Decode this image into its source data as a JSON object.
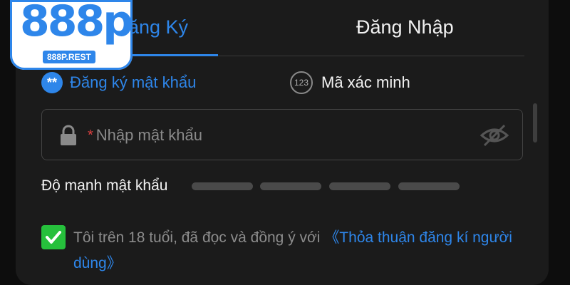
{
  "logo": {
    "brand": "888p",
    "domain": "888P.REST"
  },
  "tabs": {
    "register": "ăng Ký",
    "login": "Đăng Nhập"
  },
  "methods": {
    "password_icon": "**",
    "password": "Đăng ký mật khẩu",
    "code_icon": "123",
    "code": "Mã xác minh"
  },
  "password_field": {
    "required_mark": "*",
    "placeholder": "Nhập mật khẩu",
    "value": ""
  },
  "strength": {
    "label": "Độ mạnh mật khẩu",
    "segments": 4,
    "level": 0
  },
  "terms": {
    "checked": true,
    "text": "Tôi trên 18 tuổi, đã đọc và đồng ý với ",
    "link": "《Thỏa thuận đăng kí người dùng》"
  },
  "icons": [
    "lock-icon",
    "eye-off-icon",
    "check-icon"
  ],
  "colors": {
    "accent": "#2e86ea",
    "checkbox": "#26c03c",
    "required": "#e04040",
    "panel": "#1b1b1b"
  }
}
